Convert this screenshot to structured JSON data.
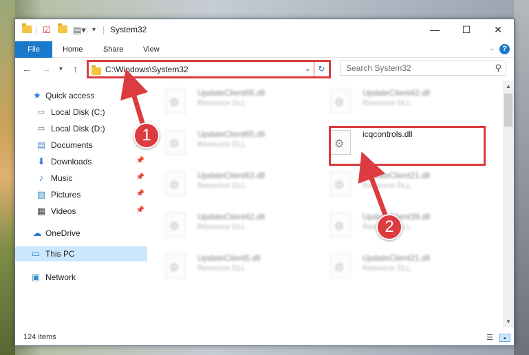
{
  "window": {
    "title": "System32"
  },
  "ribbon": {
    "tabs": [
      "File",
      "Home",
      "Share",
      "View"
    ]
  },
  "nav": {
    "address": "C:\\Windows\\System32",
    "search_placeholder": "Search System32"
  },
  "sidebar": {
    "items": [
      {
        "label": "Quick access",
        "icon": "star-icon",
        "pinned": false
      },
      {
        "label": "Local Disk (C:)",
        "icon": "drive-icon",
        "pinned": false
      },
      {
        "label": "Local Disk (D:)",
        "icon": "drive-icon",
        "pinned": false
      },
      {
        "label": "Documents",
        "icon": "documents-icon",
        "pinned": true
      },
      {
        "label": "Downloads",
        "icon": "download-icon",
        "pinned": true
      },
      {
        "label": "Music",
        "icon": "music-icon",
        "pinned": true
      },
      {
        "label": "Pictures",
        "icon": "pictures-icon",
        "pinned": true
      },
      {
        "label": "Videos",
        "icon": "videos-icon",
        "pinned": true
      },
      {
        "label": "OneDrive",
        "icon": "cloud-icon",
        "pinned": false
      },
      {
        "label": "This PC",
        "icon": "computer-icon",
        "pinned": false,
        "selected": true
      },
      {
        "label": "Network",
        "icon": "network-icon",
        "pinned": false
      }
    ]
  },
  "files": [
    {
      "name": "UpdateClient65.dll",
      "type": "Resource DLL",
      "blurred": true
    },
    {
      "name": "UpdateClient42.dll",
      "type": "Resource DLL",
      "blurred": true
    },
    {
      "name": "UpdateClient65.dll",
      "type": "Resource DLL",
      "blurred": true
    },
    {
      "name": "icqcontrols.dll",
      "type": "",
      "blurred": false,
      "highlighted": true
    },
    {
      "name": "UpdateClient63.dll",
      "type": "Resource DLL",
      "blurred": true
    },
    {
      "name": "UpdateClient21.dll",
      "type": "Resource DLL",
      "blurred": true
    },
    {
      "name": "UpdateClient42.dll",
      "type": "Resource DLL",
      "blurred": true
    },
    {
      "name": "UpdateClient39.dll",
      "type": "Resource DLL",
      "blurred": true
    },
    {
      "name": "UpdateClient5.dll",
      "type": "Resource DLL",
      "blurred": true
    },
    {
      "name": "UpdateClient21.dll",
      "type": "Resource DLL",
      "blurred": true
    }
  ],
  "status": {
    "item_count": "124 items"
  },
  "annotations": {
    "step1": "1",
    "step2": "2",
    "color": "#dc3b3f"
  },
  "colors": {
    "accent": "#1979ca",
    "highlight": "#d9393c",
    "selected_bg": "#cce8ff"
  }
}
